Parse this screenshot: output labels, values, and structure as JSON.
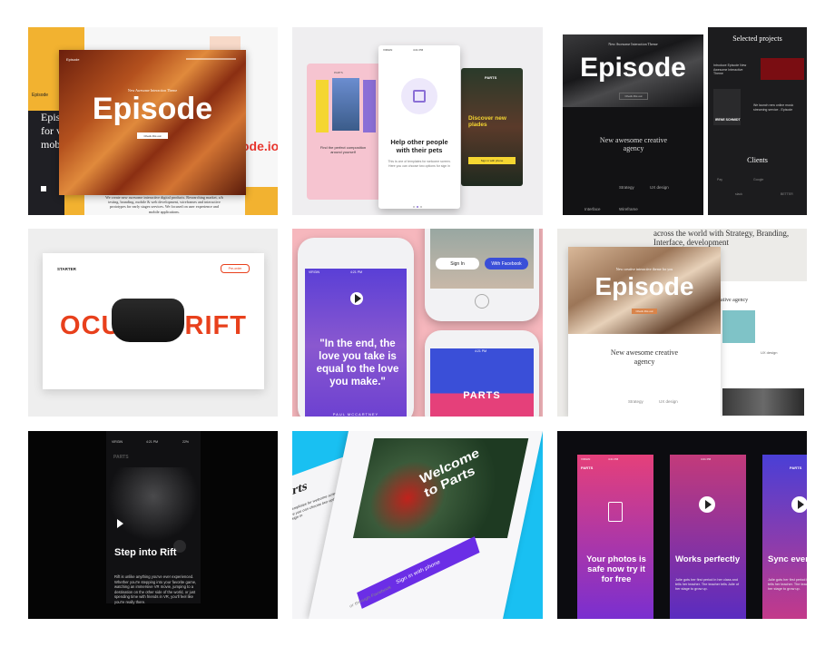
{
  "tile1": {
    "nav_brand": "Episode",
    "side_brand": "Episode",
    "subtitle": "New Awesome Interaction Theme",
    "title": "Episode",
    "cta": "Check this out",
    "side_heading": "Epis for v mob",
    "right_text": "ode.io",
    "body": "We create new awesome interactive digital products. Researching market, a/b testing, branding, mobile & web development, wireframes and interactive prototypes for early stages services. We focused on user experience and mobile applications.",
    "colors": {
      "gold": "#f2b230",
      "dark": "#1f1f24",
      "canyon": "#b4511e"
    }
  },
  "tile2": {
    "carrier": "VIRGIN",
    "time": "4:21 PM",
    "parts_small": "PARTS",
    "heading": "Help other people with their pets",
    "body": "This is one of templates for welcome screen. Here you can choose two options for sign in",
    "left_caption": "Find the perfect composition around yourself",
    "right_brand": "PARTS",
    "right_heading": "Discover new plades",
    "right_btn": "Sign in with phone",
    "colors": {
      "bg": "#efeef0",
      "pink": "#f6c4d0",
      "yellow": "#f5d631",
      "purple": "#8b6fd6"
    }
  },
  "tile3": {
    "subtitle": "New Awesome Interaction Theme",
    "title": "Episode",
    "btn": "Check this out",
    "section_heading": "New awesome creative agency",
    "col1": "Strategy",
    "col2": "UX design",
    "col3": "Interface",
    "col4": "Wireframe",
    "right_title": "Selected projects",
    "intro_text": "Introduce Episode New Awesome Interactive Theme",
    "launch_text": "We launch new online music streaming service - Episode",
    "artist": "IRENE SCHMIDT",
    "clients": "Clients",
    "logos": [
      "Pay",
      "Google",
      "slack",
      "BETTER"
    ]
  },
  "tile4": {
    "brand": "STARTER",
    "button": "Pre-order",
    "title": "OCULUS RIFT",
    "colors": {
      "red": "#e8401c",
      "bg": "#eeeeee"
    }
  },
  "tile5": {
    "carrier": "VIRGIN",
    "time": "4:21 PM",
    "quote": "\"In the end, the love you take is equal to the love you make.\"",
    "author": "PAUL MCCARTNEY",
    "signin": "Sign In",
    "facebook": "With Facebook",
    "brand": "PARTS",
    "colors": {
      "bg": "#f6b7bd",
      "purple": "#6a3fd1",
      "blue": "#3a4fd8",
      "pink": "#e5407a"
    }
  },
  "tile6": {
    "top_text": "across the world with Strategy, Branding, Interface, development",
    "subtitle": "New creative interactive theme for you",
    "title": "Episode",
    "btn": "Check this out",
    "section_heading": "New awesome creative agency",
    "col1": "Strategy",
    "col2": "UX design",
    "right_heading": "ative agency",
    "right_label": "UX design"
  },
  "tile7": {
    "carrier": "VIRGIN",
    "time": "4:21 PM",
    "battery": "22%",
    "brand": "PARTS",
    "heading": "Step into Rift",
    "body": "Rift is unlike anything you've ever experienced. Whether you're stepping into your favorite game, watching an immersive VR movie, jumping to a destination on the other side of the world, or just spending time with friends in VR, you'll feel like you're really there."
  },
  "tile8": {
    "heading": "Welcome to Parts",
    "left_text": "of templates for welcome screen. Here you can choose two options for sign in",
    "left_heading": "rts",
    "btn_primary": "Sign in with phone",
    "btn_secondary": "or through Facebook",
    "colors": {
      "bg": "#19c0f2",
      "purple": "#6b2ee6"
    }
  },
  "tile9": {
    "carrier": "VIRGIN",
    "time": "4:21 PM",
    "battery": "22%",
    "brand": "PARTS",
    "screen1": "Your photos is safe now try it for free",
    "screen2_heading": "Works perfectly",
    "screen2_body": "Julie gots her first period in her class and tells her teacher. The teacher tells Julie of her stage to grow up.",
    "screen3_heading": "Sync everything",
    "screen3_body": "Julie gots her first period in her class and tells her teacher. The teacher tells Julie of her stage to grow up."
  }
}
